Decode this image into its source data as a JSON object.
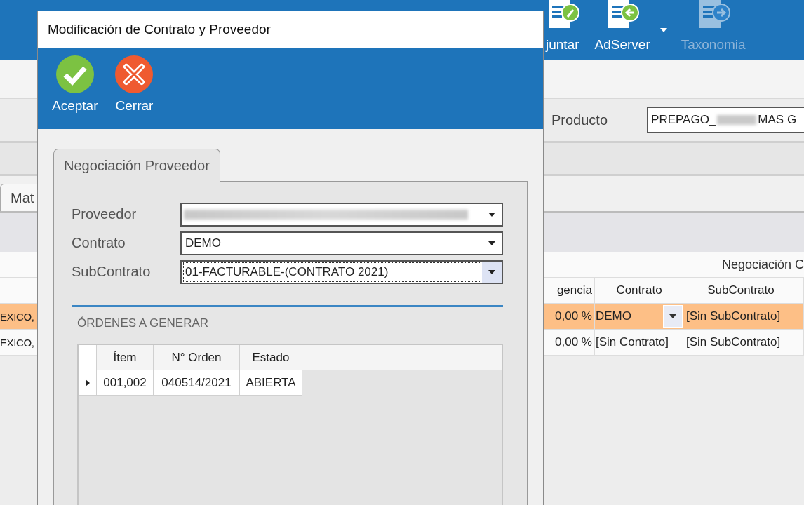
{
  "background": {
    "ribbon": [
      {
        "label": "juntar",
        "kind": "attach",
        "disabled": false,
        "dropdown": false
      },
      {
        "label": "AdServer",
        "kind": "adserver",
        "disabled": false,
        "dropdown": true
      },
      {
        "label": "Taxonomia",
        "kind": "taxonomy",
        "disabled": true,
        "dropdown": false
      }
    ],
    "filter": {
      "label": "Producto",
      "value_start": "PREPAGO_",
      "value_end": "MAS G"
    },
    "tabs": [
      {
        "label": "Mat",
        "selected": true
      }
    ],
    "grid": {
      "group_header": "Negociación C",
      "columns": [
        "",
        "gencia",
        "Contrato",
        "SubContrato"
      ],
      "rows": [
        {
          "cells": [
            "EXICO,",
            "0,00 %",
            "DEMO",
            "[Sin SubContrato]"
          ],
          "selected": true,
          "editing": true
        },
        {
          "cells": [
            "EXICO,",
            "0,00 %",
            "[Sin Contrato]",
            "[Sin SubContrato]"
          ],
          "selected": false,
          "editing": false
        }
      ]
    }
  },
  "dialog": {
    "title": "Modificación de Contrato y Proveedor",
    "toolbar": [
      {
        "label": "Aceptar",
        "kind": "accept"
      },
      {
        "label": "Cerrar",
        "kind": "close"
      }
    ],
    "tab": {
      "label": "Negociación Proveedor",
      "selected": true
    },
    "fields": [
      {
        "label": "Proveedor",
        "redacted": true,
        "focused": false
      },
      {
        "label": "Contrato",
        "value": "DEMO",
        "redacted": false,
        "focused": false
      },
      {
        "label": "SubContrato",
        "value": "01-FACTURABLE-(CONTRATO 2021)",
        "redacted": false,
        "focused": true
      }
    ],
    "section": "ÓRDENES A GENERAR",
    "orders": {
      "columns": [
        "Ítem",
        "N° Orden",
        "Estado"
      ],
      "rows": [
        {
          "cells": [
            "001,002",
            "040514/2021",
            "ABIERTA"
          ],
          "current": true
        }
      ]
    }
  }
}
